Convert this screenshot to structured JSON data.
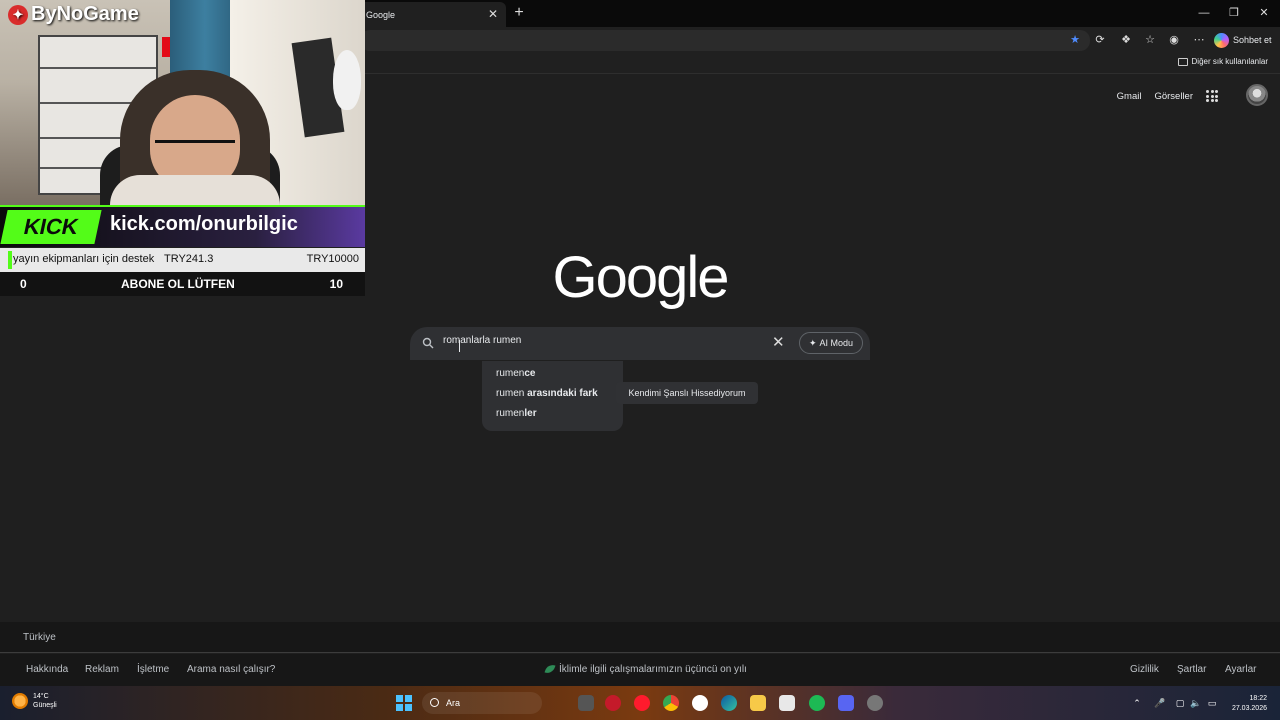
{
  "browser": {
    "tab_title": "Google",
    "tab_close": "✕",
    "new_tab": "+",
    "copilot_label": "Sohbet et",
    "bookmarks_other": "Diğer sık kullanılanlar"
  },
  "google": {
    "top_links": [
      "Gmail",
      "Görseller"
    ],
    "logo_text": "Google",
    "search_value": "romanlarla rumen",
    "ai_mode_label": "AI Modu",
    "suggestions": [
      {
        "prefix": "rumen",
        "bold": "ce"
      },
      {
        "prefix": "rumen ",
        "bold": "arasındaki fark"
      },
      {
        "prefix": "rumen",
        "bold": "ler"
      }
    ],
    "lucky_button": "Kendimi Şanslı Hissediyorum"
  },
  "footer": {
    "country": "Türkiye",
    "left_links": [
      "Hakkında",
      "Reklam",
      "İşletme",
      "Arama nasıl çalışır?"
    ],
    "climate_text": "İklimle ilgili çalışmalarımızın üçüncü on yılı",
    "right_links": [
      "Gizlilik",
      "Şartlar",
      "Ayarlar"
    ]
  },
  "taskbar": {
    "weather_temp": "14°C",
    "weather_desc": "Güneşli",
    "search_label": "Ara",
    "clock_time": "18:22",
    "clock_date": "27.03.2026"
  },
  "overlay": {
    "brand": "ByNoGame",
    "kick_logo": "KICK",
    "kick_url": "kick.com/onurbilgic",
    "donation_goal_label": "yayın ekipmanları için destek",
    "donation_current": "TRY241.3",
    "donation_target": "TRY10000",
    "sub_current": "0",
    "sub_label": "ABONE OL LÜTFEN",
    "sub_target": "10"
  },
  "colors": {
    "page_bg": "#1f1f1f",
    "kick_green": "#53fc18",
    "search_box": "#2f3033"
  }
}
